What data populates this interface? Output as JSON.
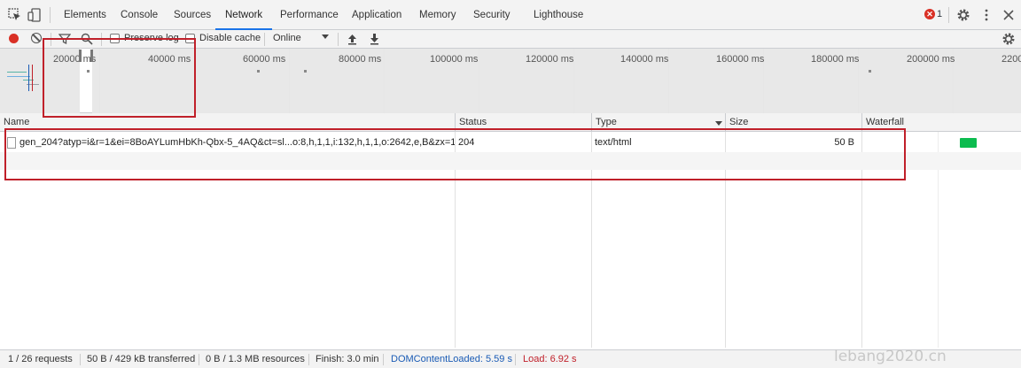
{
  "tabs": {
    "items": [
      "Elements",
      "Console",
      "Sources",
      "Network",
      "Performance",
      "Application",
      "Memory",
      "Security",
      "Lighthouse"
    ],
    "active": "Network",
    "error_count": "1"
  },
  "toolbar": {
    "preserve_log": "Preserve log",
    "disable_cache": "Disable cache",
    "throttling": "Online"
  },
  "overview": {
    "ticks": [
      "20000 ms",
      "40000 ms",
      "60000 ms",
      "80000 ms",
      "100000 ms",
      "120000 ms",
      "140000 ms",
      "160000 ms",
      "180000 ms",
      "200000 ms",
      "2200"
    ]
  },
  "table": {
    "headers": {
      "name": "Name",
      "status": "Status",
      "type": "Type",
      "size": "Size",
      "waterfall": "Waterfall"
    },
    "rows": [
      {
        "name": "gen_204?atyp=i&r=1&ei=8BoAYLumHbKh-Qbx-5_4AQ&ct=sl...o:8,h,1,1,i:132,h,1,1,o:2642,e,B&zx=1...",
        "status": "204",
        "type": "text/html",
        "size": "50 B"
      }
    ]
  },
  "status": {
    "requests": "1 / 26 requests",
    "transferred": "50 B / 429 kB transferred",
    "resources": "0 B / 1.3 MB resources",
    "finish": "Finish: 3.0 min",
    "dcl": "DOMContentLoaded: 5.59 s",
    "load": "Load: 6.92 s"
  },
  "watermark": "lebang2020.cn",
  "colors": {
    "accent": "#1a73e8",
    "record": "#d93025",
    "dcl": "#1a5bb5",
    "load": "#c0202a",
    "waterfall_bar": "#0cbc4f",
    "annotation": "#c0202a"
  }
}
